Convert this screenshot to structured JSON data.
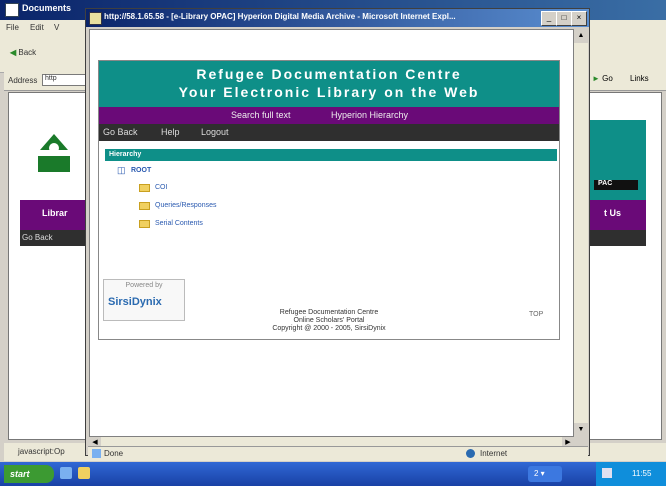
{
  "background_window": {
    "title": "Documents",
    "menu": [
      "File",
      "Edit",
      "V"
    ],
    "back_label": "Back",
    "address_label": "Address",
    "address_value": "http",
    "go_label": "Go",
    "links_label": "Links",
    "left_panel_label": "Librar",
    "right_panel_label": "t Us",
    "right_badge": "PAC",
    "go_back": "Go Back",
    "status_text": "javascript:Op"
  },
  "popup": {
    "title": "http://58.1.65.58 - [e-Library OPAC] Hyperion Digital Media Archive - Microsoft Internet Expl...",
    "banner_line1": "Refugee Documentation Centre",
    "banner_line2": "Your Electronic Library on the Web",
    "nav_links": [
      "Search full text",
      "Hyperion Hierarchy"
    ],
    "toolbar_links": [
      "Go Back",
      "Help",
      "Logout"
    ],
    "hierarchy_header": "Hierarchy",
    "root_label": "ROOT",
    "folders": [
      "COI",
      "Queries/Responses",
      "Serial Contents"
    ],
    "powered_by": "Powered by",
    "vendor_logo": "SirsiDynix",
    "footer_lines": [
      "Refugee Documentation Centre",
      "Online Scholars' Portal",
      "Copyright @ 2000 - 2005, SirsiDynix"
    ],
    "top_link": "TOP",
    "status_left": "Done",
    "status_zone": "Internet"
  },
  "taskbar": {
    "start_label": "start",
    "clock": "11:55"
  }
}
